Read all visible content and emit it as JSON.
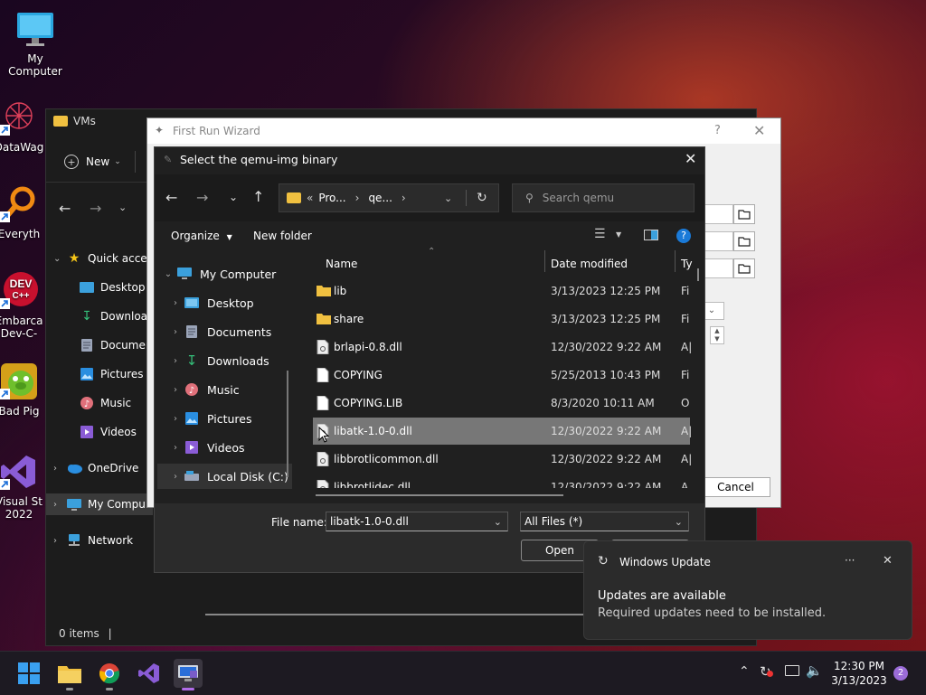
{
  "desktop": {
    "icons": [
      {
        "label": "My Computer"
      },
      {
        "label": "DataWag"
      },
      {
        "label": "Everyth"
      },
      {
        "label": "Embarca Dev-C-"
      },
      {
        "label": "Bad Pig"
      },
      {
        "label": "Visual St 2022"
      }
    ]
  },
  "explorer": {
    "title": "VMs",
    "new_label": "New",
    "nav": [
      "Quick acces",
      "Desktop",
      "Download",
      "Documen",
      "Pictures",
      "Music",
      "Videos",
      "OneDrive",
      "My Compu",
      "Network"
    ],
    "status": "0 items"
  },
  "wizard": {
    "title": "First Run Wizard",
    "help": "?",
    "cancel_label": "Cancel"
  },
  "dialog": {
    "title": "Select the qemu-img binary",
    "breadcrumb": [
      "Pro...",
      "qe..."
    ],
    "breadcrumb_prefix": "«",
    "search_placeholder": "Search qemu",
    "organize_label": "Organize",
    "new_folder_label": "New folder",
    "sidebar": [
      "My Computer",
      "Desktop",
      "Documents",
      "Downloads",
      "Music",
      "Pictures",
      "Videos",
      "Local Disk (C:)"
    ],
    "columns": {
      "name": "Name",
      "date": "Date modified",
      "type": "Ty"
    },
    "files": [
      {
        "name": "lib",
        "date": "3/13/2023 12:25 PM",
        "type": "Fi",
        "kind": "folder"
      },
      {
        "name": "share",
        "date": "3/13/2023 12:25 PM",
        "type": "Fi",
        "kind": "folder"
      },
      {
        "name": "brlapi-0.8.dll",
        "date": "12/30/2022 9:22 AM",
        "type": "A|",
        "kind": "dll"
      },
      {
        "name": "COPYING",
        "date": "5/25/2013 10:43 PM",
        "type": "Fi",
        "kind": "file"
      },
      {
        "name": "COPYING.LIB",
        "date": "8/3/2020 10:11 AM",
        "type": "O",
        "kind": "file"
      },
      {
        "name": "libatk-1.0-0.dll",
        "date": "12/30/2022 9:22 AM",
        "type": "A|",
        "kind": "dll"
      },
      {
        "name": "libbrotlicommon.dll",
        "date": "12/30/2022 9:22 AM",
        "type": "A|",
        "kind": "dll"
      },
      {
        "name": "libbrotlidec.dll",
        "date": "12/30/2022 9:22 AM",
        "type": "A",
        "kind": "dll"
      }
    ],
    "file_name_label": "File name:",
    "file_name_value": "libatk-1.0-0.dll",
    "file_type_value": "All Files  (*)",
    "open_label": "Open"
  },
  "toast": {
    "app": "Windows Update",
    "more": "···",
    "heading": "Updates are available",
    "body": "Required updates need to be installed."
  },
  "taskbar": {
    "time": "12:30 PM",
    "date": "3/13/2023",
    "notifications": "2"
  }
}
